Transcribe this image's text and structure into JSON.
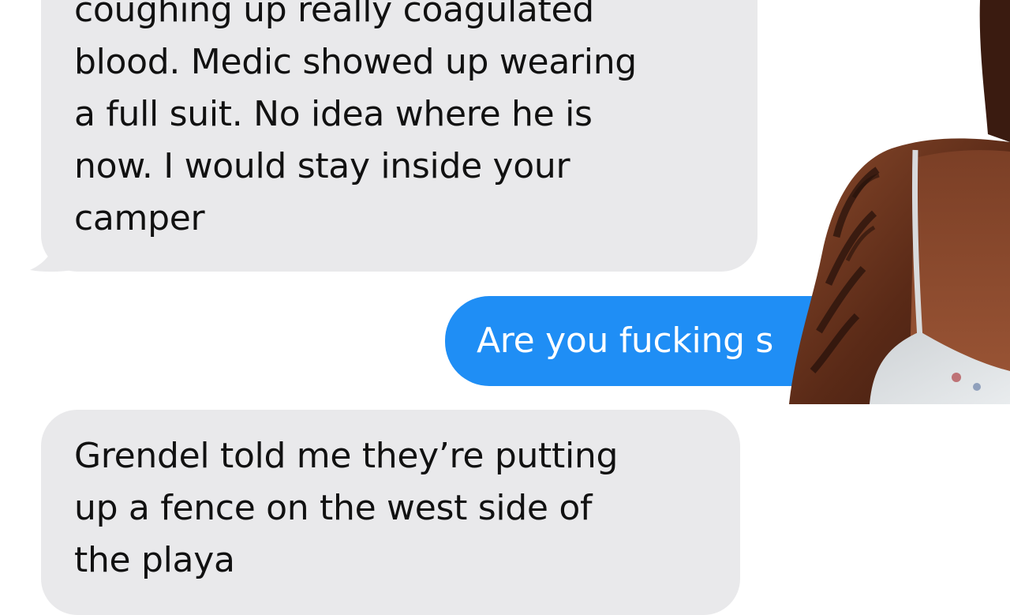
{
  "conversation": {
    "messages": [
      {
        "direction": "received",
        "text": "coughing up really coagulated\nblood. Medic showed up wearing\na full suit. No idea where he is\nnow. I would stay inside your\ncamper"
      },
      {
        "direction": "sent",
        "text": "Are you fucking s"
      },
      {
        "direction": "received",
        "text": "Grendel told me they’re  putting\nup a fence on the west side of\nthe playa"
      }
    ]
  },
  "colors": {
    "received_bubble": "#e9e9eb",
    "sent_bubble": "#1f8ef5",
    "received_text": "#111111",
    "sent_text": "#ffffff"
  }
}
